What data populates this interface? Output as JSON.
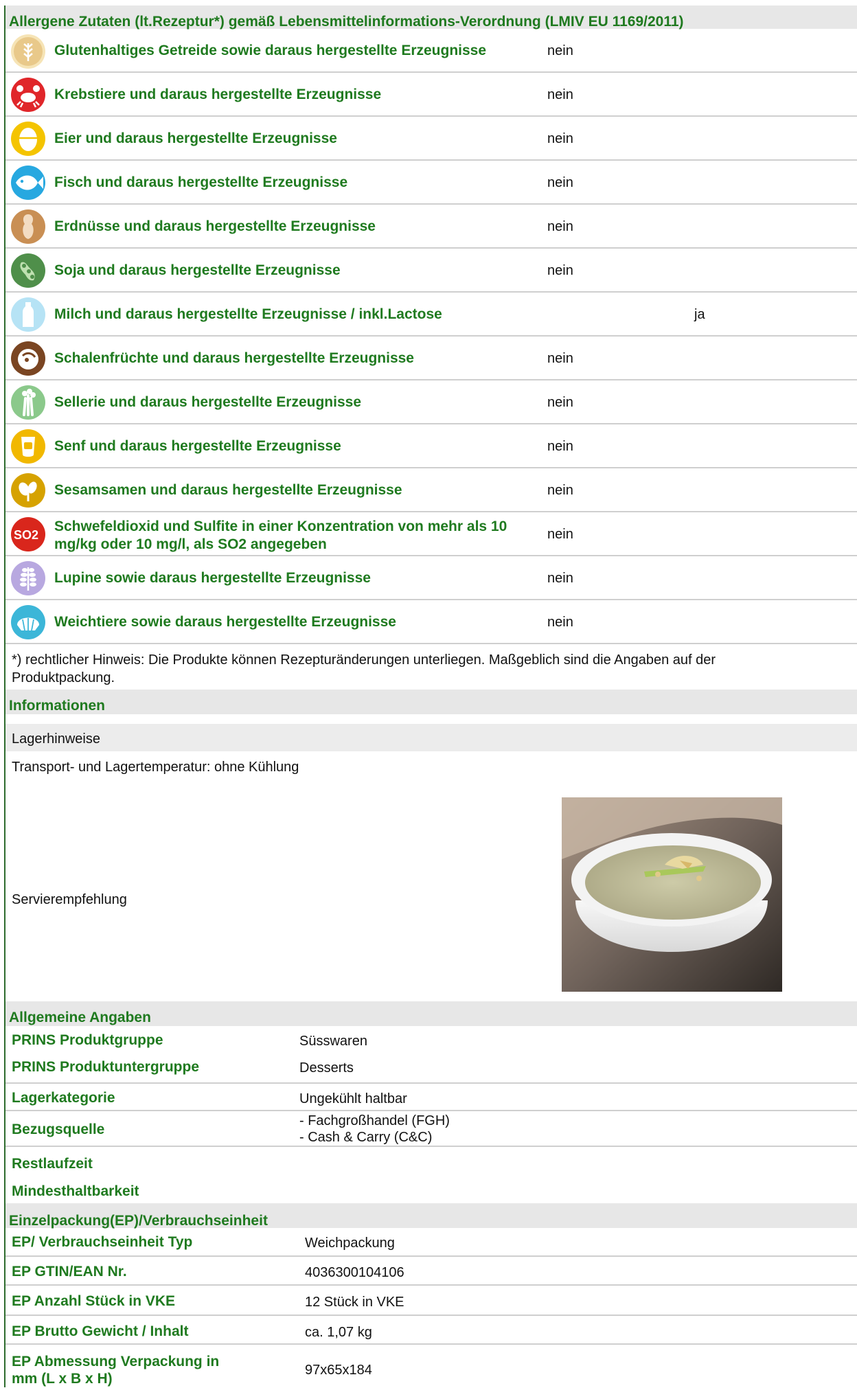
{
  "allergen_section": {
    "title": "Allergene Zutaten (lt.Rezeptur*) gemäß Lebensmittelinformations-Verordnung (LMIV EU 1169/2011)",
    "rows": [
      {
        "label": "Glutenhaltiges Getreide sowie daraus hergestellte Erzeugnisse",
        "nein": "nein",
        "ja": "",
        "icon": "wheat-icon"
      },
      {
        "label": "Krebstiere und daraus hergestellte Erzeugnisse",
        "nein": "nein",
        "ja": "",
        "icon": "crab-icon"
      },
      {
        "label": "Eier und daraus hergestellte Erzeugnisse",
        "nein": "nein",
        "ja": "",
        "icon": "egg-icon"
      },
      {
        "label": "Fisch und daraus hergestellte Erzeugnisse",
        "nein": "nein",
        "ja": "",
        "icon": "fish-icon"
      },
      {
        "label": "Erdnüsse und daraus hergestellte Erzeugnisse",
        "nein": "nein",
        "ja": "",
        "icon": "peanut-icon"
      },
      {
        "label": "Soja und daraus hergestellte Erzeugnisse",
        "nein": "nein",
        "ja": "",
        "icon": "soy-icon"
      },
      {
        "label": "Milch und daraus hergestellte Erzeugnisse / inkl.Lactose",
        "nein": "",
        "ja": "ja",
        "icon": "milk-icon"
      },
      {
        "label": "Schalenfrüchte und daraus hergestellte Erzeugnisse",
        "nein": "nein",
        "ja": "",
        "icon": "nut-icon"
      },
      {
        "label": "Sellerie und daraus hergestellte Erzeugnisse",
        "nein": "nein",
        "ja": "",
        "icon": "celery-icon"
      },
      {
        "label": "Senf und daraus hergestellte Erzeugnisse",
        "nein": "nein",
        "ja": "",
        "icon": "mustard-icon"
      },
      {
        "label": "Sesamsamen und daraus hergestellte Erzeugnisse",
        "nein": "nein",
        "ja": "",
        "icon": "sesame-icon"
      },
      {
        "label": "Schwefeldioxid und Sulfite in einer Konzentration von mehr als 10 mg/kg oder 10 mg/l, als SO2 angegeben",
        "nein": "nein",
        "ja": "",
        "icon": "sulfite-icon",
        "icon_text": "SO2"
      },
      {
        "label": "Lupine sowie daraus hergestellte Erzeugnisse",
        "nein": "nein",
        "ja": "",
        "icon": "lupine-icon"
      },
      {
        "label": "Weichtiere sowie daraus hergestellte Erzeugnisse",
        "nein": "nein",
        "ja": "",
        "icon": "shell-icon"
      }
    ],
    "footnote": "*) rechtlicher Hinweis: Die Produkte können Rezepturänderungen unterliegen. Maßgeblich sind die Angaben auf der Produktpackung."
  },
  "info_section": {
    "title": "Informationen",
    "storage_heading": "Lagerhinweise",
    "storage_text": "Transport- und Lagertemperatur: ohne Kühlung",
    "serving_label": "Servierempfehlung"
  },
  "general_section": {
    "title": "Allgemeine Angaben",
    "rows": [
      {
        "key": "PRINS Produktgruppe",
        "value": "Süsswaren"
      },
      {
        "key": "PRINS Produktuntergruppe",
        "value": "Desserts"
      },
      {
        "key": "Lagerkategorie",
        "value": "Ungekühlt haltbar"
      },
      {
        "key": "Bezugsquelle",
        "value_lines": [
          "- Fachgroßhandel (FGH)",
          "- Cash & Carry (C&C)"
        ]
      },
      {
        "key": "Restlaufzeit",
        "value": ""
      },
      {
        "key": "Mindesthaltbarkeit",
        "value": ""
      }
    ]
  },
  "package_section": {
    "title": "Einzelpackung(EP)/Verbrauchseinheit",
    "rows": [
      {
        "key": "EP/ Verbrauchseinheit Typ",
        "value": "Weichpackung"
      },
      {
        "key": "EP GTIN/EAN Nr.",
        "value": "4036300104106"
      },
      {
        "key": "EP Anzahl Stück in VKE",
        "value": "12 Stück in VKE"
      },
      {
        "key": "EP Brutto Gewicht / Inhalt",
        "value": "ca. 1,07 kg"
      },
      {
        "key_lines": [
          "EP Abmessung Verpackung in",
          "mm  (L x B x H)"
        ],
        "value": "97x65x184"
      }
    ]
  },
  "colors": {
    "label_green": "#1f7a1f",
    "header_gray": "#e7e7e7",
    "divider": "#cfcfcf"
  }
}
